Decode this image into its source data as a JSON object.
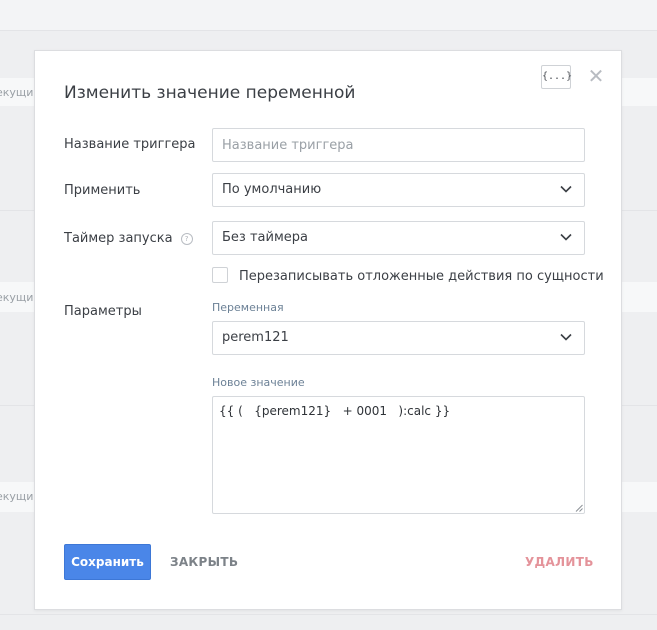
{
  "background": {
    "fragments": [
      "екущий",
      "екущий",
      "екущий"
    ]
  },
  "modal": {
    "title": "Изменить значение переменной",
    "variables_button": "{...}",
    "close_symbol": "✕"
  },
  "form": {
    "trigger_name": {
      "label": "Название триггера",
      "placeholder": "Название триггера",
      "value": ""
    },
    "apply": {
      "label": "Применить",
      "selected": "По умолчанию"
    },
    "timer": {
      "label": "Таймер запуска",
      "help": "?",
      "selected": "Без таймера"
    },
    "overwrite_checkbox": {
      "label": "Перезаписывать отложенные действия по сущности",
      "checked": false
    },
    "parameters": {
      "label": "Параметры",
      "variable_label": "Переменная",
      "variable_selected": "perem121",
      "new_value_label": "Новое значение",
      "new_value": "{{ (   {perem121}   + 0001   ):calc }}"
    }
  },
  "actions": {
    "save": "Сохранить",
    "close": "ЗАКРЫТЬ",
    "delete": "УДАЛИТЬ"
  },
  "colors": {
    "primary": "#4a86e8",
    "danger": "#e4939a",
    "muted": "#7c8288"
  }
}
